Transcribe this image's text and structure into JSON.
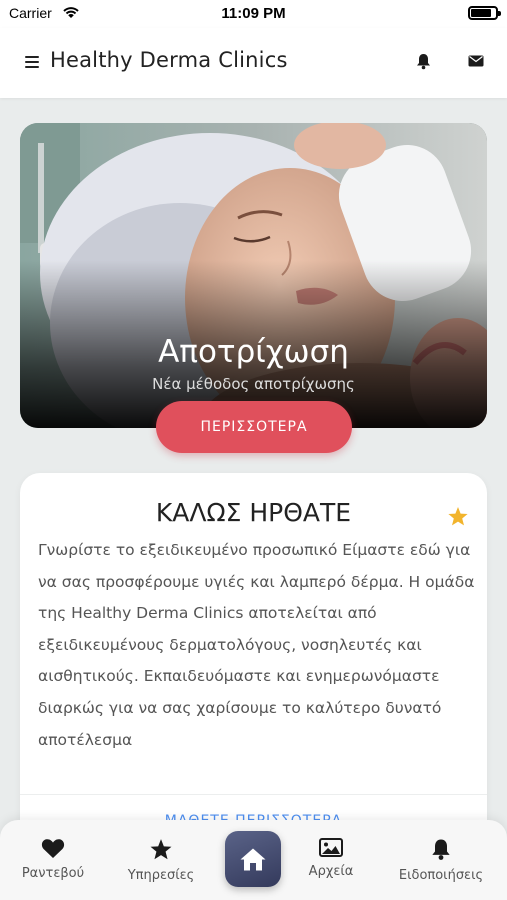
{
  "status_bar": {
    "carrier": "Carrier",
    "time": "11:09 PM",
    "battery_level": 0.92,
    "wifi_icon": "wifi-icon",
    "battery_icon": "battery-icon"
  },
  "header": {
    "title": "Healthy Derma Clinics",
    "menu_icon": "menu-icon",
    "notifications_icon": "bell-icon",
    "messages_icon": "mail-icon"
  },
  "hero": {
    "title": "Αποτρίχωση",
    "subtitle": "Νέα μέθοδος αποτρίχωσης",
    "button_label": "ΠΕΡΙΣΣΟΤΕΡΑ",
    "button_color": "#e0505c"
  },
  "welcome": {
    "title": "ΚΑΛΩΣ ΗΡΘΑΤΕ",
    "star_icon": "star-icon",
    "star_color": "#f2b42c",
    "body": "Γνωρίστε το εξειδικευμένο προσωπικό Είμαστε εδώ για να σας προσφέρουμε υγιές και λαμπερό δέρμα. Η ομάδα της Healthy Derma Clinics αποτελείται από εξειδικευμένους δερματολόγους, νοσηλευτές και αισθητικούς. Εκπαιδευόμαστε και ενημερωνόμαστε διαρκώς για να σας χαρίσουμε το καλύτερο δυνατό αποτέλεσμα",
    "more_label": "ΜΑΘΕΤΕ ΠΕΡΙΣΣΟΤΕΡΑ",
    "link_color": "#4d8ef0"
  },
  "bottom_nav": {
    "items": [
      {
        "label": "Ραντεβού",
        "icon": "heart-icon"
      },
      {
        "label": "Υπηρεσίες",
        "icon": "star-icon"
      },
      {
        "label": "",
        "icon": "home-icon"
      },
      {
        "label": "Αρχεία",
        "icon": "image-icon"
      },
      {
        "label": "Ειδοποιήσεις",
        "icon": "bell-icon"
      }
    ],
    "home_color": "#3f4668"
  }
}
